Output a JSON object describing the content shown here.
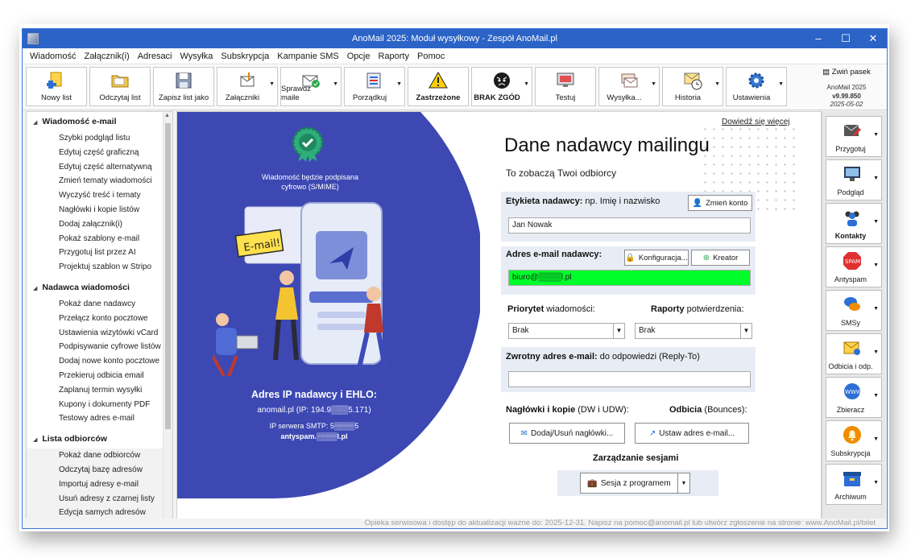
{
  "window": {
    "title": "AnoMail 2025: Moduł wysyłkowy - Zespół AnoMail.pl",
    "minimize": "–",
    "maximize": "☐",
    "close": "✕"
  },
  "menu": [
    "Wiadomość",
    "Załącznik(i)",
    "Adresaci",
    "Wysyłka",
    "Subskrypcja",
    "Kampanie SMS",
    "Opcje",
    "Raporty",
    "Pomoc"
  ],
  "toolbar": {
    "buttons": [
      {
        "label": "Nowy list",
        "icon": "new-document-icon"
      },
      {
        "label": "Odczytaj list",
        "icon": "folder-open-icon"
      },
      {
        "label": "Zapisz list jako",
        "icon": "save-as-icon"
      },
      {
        "label": "Załączniki",
        "icon": "attachment-icon"
      },
      {
        "label": "Sprawdź maile",
        "icon": "check-mail-icon"
      },
      {
        "label": "Porządkuj",
        "icon": "sort-list-icon"
      },
      {
        "label": "Zastrzeżone",
        "icon": "warning-icon"
      },
      {
        "label": "BRAK ZGÓD",
        "icon": "angry-face-icon"
      },
      {
        "label": "Testuj",
        "icon": "monitor-test-icon"
      },
      {
        "label": "Wysyłka...",
        "icon": "send-mails-icon"
      },
      {
        "label": "Historia",
        "icon": "history-clock-icon"
      },
      {
        "label": "Ustawienia",
        "icon": "gear-icon"
      }
    ],
    "collapse_label": "Zwiń pasek",
    "version_app": "AnoMail 2025",
    "version": "v9.99.850",
    "date": "2025-05-02"
  },
  "sidebar": {
    "sections": [
      {
        "title": "Wiadomość e-mail",
        "items": [
          "Szybki podgląd listu",
          "Edytuj część graficzną",
          "Edytuj część alternatywną",
          "Zmień tematy wiadomości",
          "Wyczyść treść i tematy",
          "Nagłówki i kopie listów",
          "Dodaj załącznik(i)",
          "Pokaż szablony e-mail",
          "Przygotuj list przez AI",
          "Projektuj szablon w Stripo"
        ]
      },
      {
        "title": "Nadawca wiadomości",
        "items": [
          "Pokaż dane nadawcy",
          "Przełącz konto pocztowe",
          "Ustawienia wizytówki vCard",
          "Podpisywanie cyfrowe listów",
          "Dodaj nowe konto pocztowe",
          "Przekieruj odbicia email",
          "Zaplanuj termin wysyłki",
          "Kupony i dokumenty PDF",
          "Testowy adres e-mail"
        ]
      },
      {
        "title": "Lista odbiorców",
        "items": [
          "Pokaż dane odbiorców",
          "Odczytaj bazę adresów",
          "Importuj adresy e-mail",
          "Usuń adresy z czarnej listy",
          "Edycja samych adresów"
        ]
      }
    ]
  },
  "panel": {
    "signature_text": "Wiadomość będzie podpisana cyfrowo (S/MIME)",
    "email_bubble": "E-mail!",
    "ip_title": "Adres IP nadawcy i EHLO:",
    "ip_line": "anomail.pl (IP: 194.9▒▒▒5.171)",
    "smtp_line": "IP serwera SMTP: 5▒▒▒▒5",
    "smtp_host": "antyspam.▒▒▒▒l.pl"
  },
  "form": {
    "more_link": "Dowiedź się więcej",
    "heading": "Dane nadawcy mailingu",
    "subheading": "To zobaczą Twoi odbiorcy",
    "label_bold": "Etykieta nadawcy:",
    "label_hint": " np. Imię i nazwisko",
    "change_account": "Zmień konto",
    "label_value": "Jan Nowak",
    "email_label": "Adres e-mail nadawcy:",
    "config_button": "Konfiguracja...",
    "creator_button": "Kreator",
    "email_value": "biuro@▒▒▒▒l.pl",
    "priority_bold": "Priorytet",
    "priority_rest": " wiadomości:",
    "reports_bold": "Raporty",
    "reports_rest": " potwierdzenia:",
    "priority_value": "Brak",
    "reports_value": "Brak",
    "reply_bold": "Zwrotny adres e-mail:",
    "reply_rest": " do odpowiedzi (Reply-To)",
    "reply_value": "",
    "headers_bold": "Nagłówki i kopie",
    "headers_rest": " (DW i UDW):",
    "bounce_bold": "Odbicia",
    "bounce_rest": " (Bounces):",
    "headers_button": "Dodaj/Usuń nagłówki...",
    "bounce_button": "Ustaw adres e-mail...",
    "session_title": "Zarządzanie sesjami",
    "session_button": "Sesja z programem"
  },
  "right_panel": [
    "Przygotuj",
    "Podgląd",
    "Kontakty",
    "Antyspam",
    "SMSy",
    "Odbicia i odp.",
    "Zbieracz",
    "Subskrypcja",
    "Archiwum"
  ],
  "status": "Opieka serwisowa i dostęp do aktualizacji ważne do: 2025-12-31. Napisz na pomoc@anomail.pl lub utwórz zgłoszenie na stronie: www.AnoMail.pl/bilet"
}
